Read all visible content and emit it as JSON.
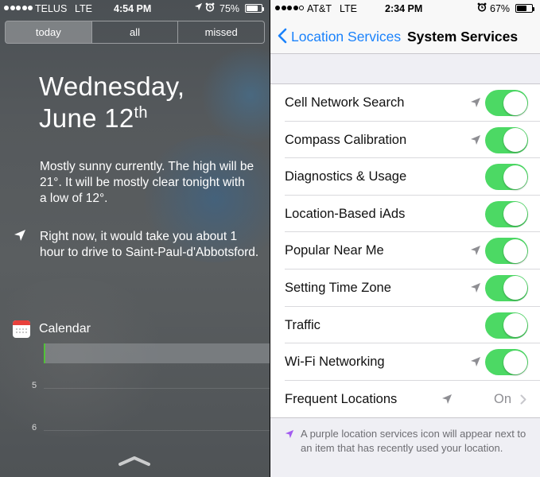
{
  "left": {
    "status": {
      "carrier": "TELUS",
      "network": "LTE",
      "time": "4:54 PM",
      "battery": "75%",
      "battery_level": 0.75
    },
    "tabs": [
      {
        "label": "today",
        "active": true
      },
      {
        "label": "all",
        "active": false
      },
      {
        "label": "missed",
        "active": false
      }
    ],
    "date": {
      "weekday": "Wednesday,",
      "month_day": "June 12",
      "suffix": "th"
    },
    "weather": "Mostly sunny currently. The high will be 21°. It will be mostly clear tonight with a low of 12°.",
    "traffic": "Right now, it would take you about 1 hour to drive to Saint-Paul-d'Abbotsford.",
    "calendar": {
      "title": "Calendar",
      "hours": [
        "5",
        "6"
      ]
    },
    "icons": {
      "location": "location-arrow-icon",
      "calendar": "calendar-icon",
      "grabber": "grabber-icon"
    }
  },
  "right": {
    "status": {
      "carrier": "AT&T",
      "network": "LTE",
      "time": "2:34 PM",
      "battery": "67%",
      "battery_level": 0.67
    },
    "nav": {
      "back_label": "Location Services",
      "title": "System Services"
    },
    "rows": [
      {
        "label": "Cell Network Search",
        "arrow": true,
        "on": true
      },
      {
        "label": "Compass Calibration",
        "arrow": true,
        "on": true
      },
      {
        "label": "Diagnostics & Usage",
        "arrow": false,
        "on": true
      },
      {
        "label": "Location-Based iAds",
        "arrow": false,
        "on": true
      },
      {
        "label": "Popular Near Me",
        "arrow": true,
        "on": true
      },
      {
        "label": "Setting Time Zone",
        "arrow": true,
        "on": true
      },
      {
        "label": "Traffic",
        "arrow": false,
        "on": true
      },
      {
        "label": "Wi-Fi Networking",
        "arrow": true,
        "on": true
      }
    ],
    "frequent": {
      "label": "Frequent Locations",
      "value": "On"
    },
    "footer": "A purple location services icon will appear next to an item that has recently used your location.",
    "colors": {
      "toggle_on": "#4cd964",
      "tint": "#1a82fb",
      "purple": "#a35cf0"
    }
  }
}
